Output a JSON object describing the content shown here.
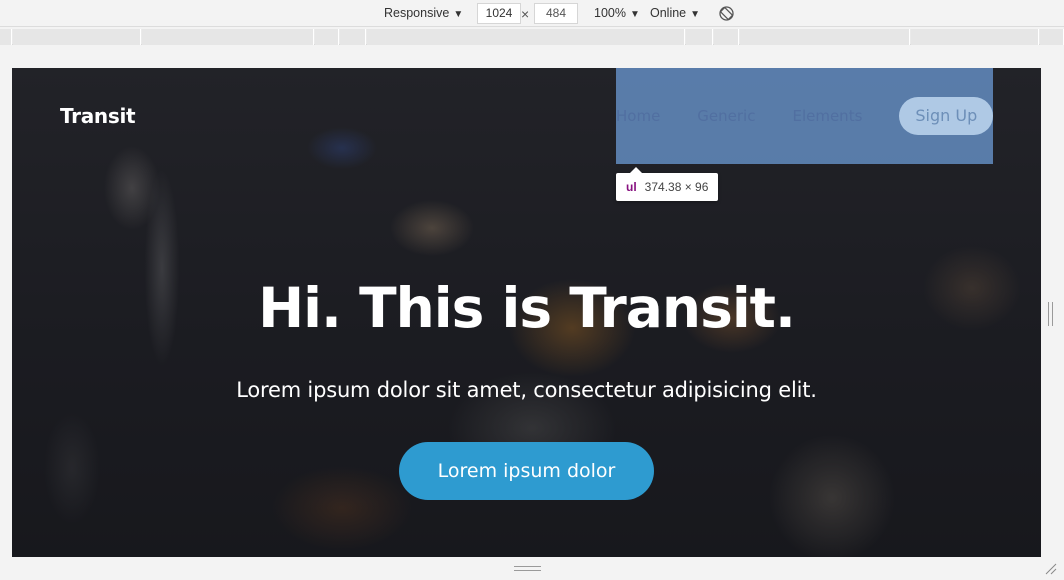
{
  "toolbar": {
    "device_mode": "Responsive",
    "width": "1024",
    "height": "484",
    "times": "×",
    "zoom": "100%",
    "network": "Online",
    "rotate_icon": "rotate-icon"
  },
  "site": {
    "brand": "Transit",
    "nav": [
      "Home",
      "Generic",
      "Elements"
    ],
    "signup": "Sign Up",
    "hero_title": "Hi. This is Transit.",
    "hero_subtitle": "Lorem ipsum dolor sit amet, consectetur adipisicing elit.",
    "cta": "Lorem ipsum dolor"
  },
  "inspector_tooltip": {
    "tag": "ul",
    "size": "374.38 × 96"
  },
  "colors": {
    "cta": "#2e9bd0",
    "highlight": "#6fa0dc",
    "tag": "#881280"
  }
}
